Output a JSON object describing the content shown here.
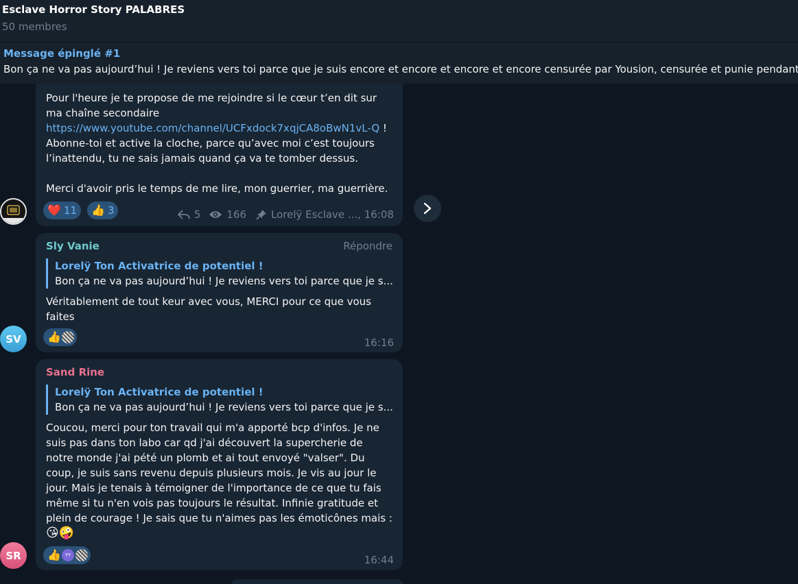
{
  "header": {
    "title": "Esclave Horror Story PALABRES",
    "members": "50 membres"
  },
  "pinned": {
    "title": "Message épinglé #1",
    "text": "Bon ça ne va pas aujourd’hui !  Je reviens vers toi parce que je suis encore et encore et encore et encore censurée par Yousion, censurée et punie pendant"
  },
  "messages": [
    {
      "lines": [
        "Pour l'heure je te propose de me rejoindre si le cœur t’en dit  sur",
        "ma chaîne secondaire"
      ],
      "link": "https://www.youtube.com/channel/UCFxdock7xqjCA8oBwN1vL-Q",
      "link_suffix": " !",
      "lines_after": [
        "Abonne-toi et active la cloche, parce qu’avec moi c’est toujours",
        "l’inattendu, tu ne sais jamais quand ça va te tomber dessus."
      ],
      "closing": "Merci d'avoir pris le temps de me lire, mon guerrier, ma guerrière.",
      "reactions": [
        {
          "emoji": "❤️",
          "count": "11"
        },
        {
          "emoji": "👍",
          "count": "3"
        }
      ],
      "replies": "5",
      "views": "166",
      "author_time": "Lorelÿ Esclave ..., 16:08"
    },
    {
      "sender": "Sly Vanie",
      "sender_color": "#6ec9cb",
      "reply_label": "Répondre",
      "quote_title": "Lorelÿ Ton Activatrice de potentiel !",
      "quote_text": "Bon ça ne va pas aujourd’hui !  Je reviens vers toi parce que je s...",
      "lines": [
        "Véritablement de tout keur avec vous, MERCI pour ce que vous",
        "faites"
      ],
      "reaction_emoji": "👍",
      "time": "16:16",
      "avatar": "SV"
    },
    {
      "sender": "Sand Rine",
      "sender_color": "#e9718f",
      "quote_title": "Lorelÿ Ton Activatrice de potentiel !",
      "quote_text": "Bon ça ne va pas aujourd’hui !  Je reviens vers toi parce que je s...",
      "lines": [
        "Coucou, merci pour ton travail qui m'a apporté bcp d'infos. Je ne",
        "suis pas dans ton labo car qd j'ai découvert la supercherie de",
        "notre monde j'ai pété un plomb et ai tout envoyé \"valser\". Du",
        "coup, je suis sans revenu depuis plusieurs mois. Je vis au jour le",
        "jour. Mais je tenais à témoigner de l'importance de ce que tu fais",
        "même si tu n'en vois pas toujours le résultat. Infinie gratitude et",
        "plein de courage ! Je sais que tu n'aimes pas les émoticônes mais :"
      ],
      "emojis": "😘🤪",
      "reaction_emoji": "👍",
      "reaction_avatar_text": "YY",
      "time": "16:44",
      "avatar": "SR"
    }
  ],
  "colors": {
    "background": "#0e1621",
    "bubble": "#182533",
    "accent": "#6ab3f3",
    "muted": "#6d7f8f"
  }
}
